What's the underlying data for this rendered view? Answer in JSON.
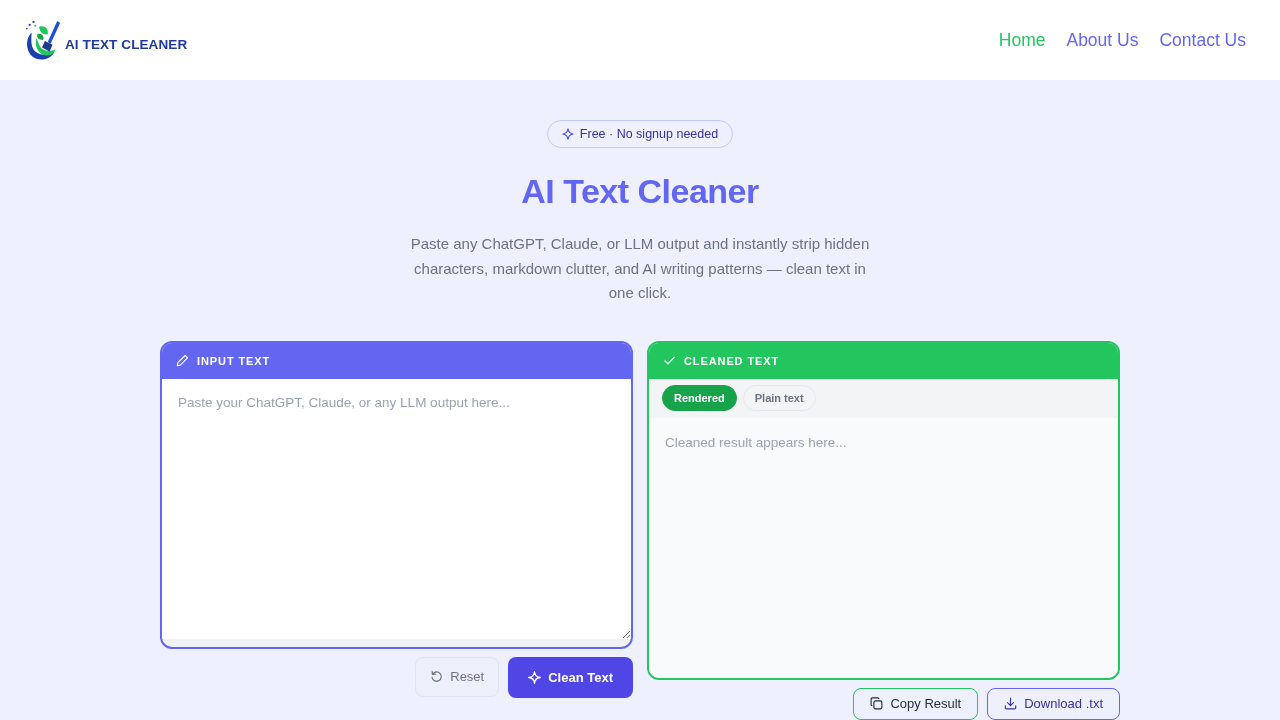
{
  "header": {
    "logo_text": "AI TEXT CLEANER",
    "nav": [
      {
        "label": "Home",
        "selected": true
      },
      {
        "label": "About Us",
        "selected": false
      },
      {
        "label": "Contact Us",
        "selected": false
      }
    ]
  },
  "hero": {
    "badge": "Free · No signup needed",
    "title": "AI Text Cleaner",
    "description": "Paste any ChatGPT, Claude, or LLM output and instantly strip hidden characters, markdown clutter, and AI writing patterns — clean text in one click."
  },
  "input_panel": {
    "title": "INPUT TEXT",
    "placeholder": "Paste your ChatGPT, Claude, or any LLM output here...",
    "buttons": [
      {
        "label": "Reset",
        "kind": "reset"
      },
      {
        "label": "Clean Text",
        "kind": "clean"
      }
    ]
  },
  "output_panel": {
    "title": "CLEANED TEXT",
    "view_tabs": [
      {
        "label": "Rendered",
        "selected": true
      },
      {
        "label": "Plain text",
        "selected": false
      }
    ],
    "placeholder": "Cleaned result appears here...",
    "buttons": [
      {
        "label": "Copy Result",
        "kind": "copy"
      },
      {
        "label": "Download .txt",
        "kind": "download"
      }
    ]
  }
}
